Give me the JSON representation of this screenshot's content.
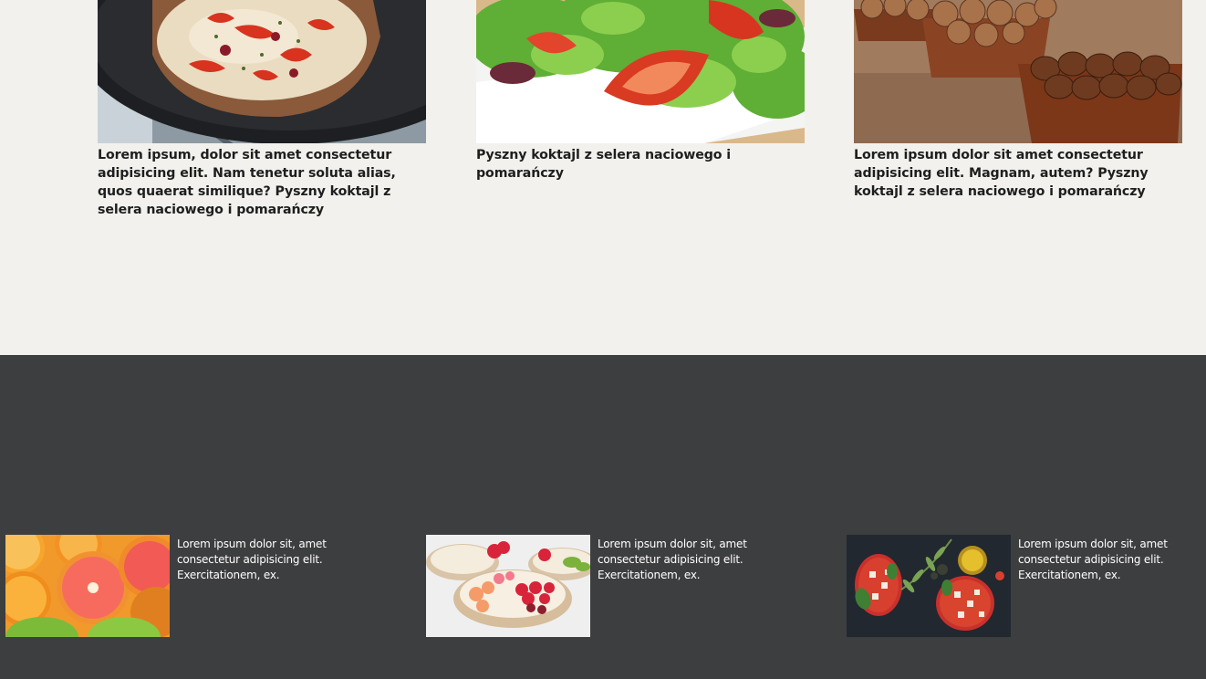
{
  "articles": [
    {
      "title": "Lorem ipsum, dolor sit amet consectetur adipisicing elit. Nam tenetur soluta alias, quos quaerat similique? Pyszny koktajl z selera naciowego i pomarańczy",
      "image": "pizza-in-pan-photo"
    },
    {
      "title": "Pyszny koktajl z selera naciowego i pomarańczy",
      "image": "tomato-salad-photo"
    },
    {
      "title": "Lorem ipsum dolor sit amet consectetur adipisicing elit. Magnam, autem? Pyszny koktajl z selera naciowego i pomarańczy",
      "image": "walnuts-bowls-photo"
    }
  ],
  "footer_items": [
    {
      "text": "Lorem ipsum dolor sit, amet consectetur adipisicing elit. Exercitationem, ex.",
      "image": "citrus-fruits-photo"
    },
    {
      "text": "Lorem ipsum dolor sit, amet consectetur adipisicing elit. Exercitationem, ex.",
      "image": "fruit-dessert-photo"
    },
    {
      "text": "Lorem ipsum dolor sit, amet consectetur adipisicing elit. Exercitationem, ex.",
      "image": "bruschetta-photo"
    }
  ],
  "colors": {
    "page_bg": "#f2f1ee",
    "footer_bg": "#3d3e40",
    "text_dark": "#1e1e1e",
    "text_light": "#ffffff"
  }
}
